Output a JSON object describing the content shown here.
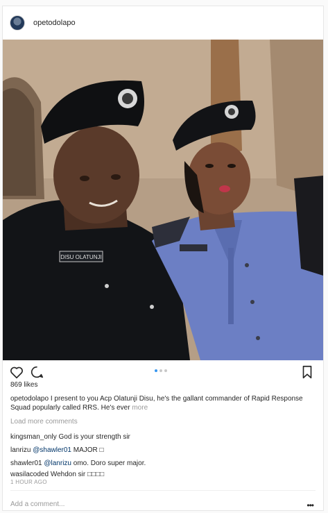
{
  "post": {
    "username": "opetodolapo",
    "likes": "869 likes",
    "caption": {
      "user": "opetodolapo",
      "text": "I present to you Acp Olatunji Disu, he's the gallant commander of Rapid Response Squad popularly called RRS. He's ever",
      "more": "more"
    },
    "load_more": "Load more comments",
    "comments": [
      {
        "user": "kingsman_only",
        "text": "God is your strength sir"
      },
      {
        "user": "lanrizu",
        "mention": "@shawler01",
        "text": "MAJOR □"
      },
      {
        "user": "shawler01",
        "mention": "@lanrizu",
        "text": "omo. Doro super major."
      },
      {
        "user": "wasilacoded",
        "text": "Wehdon sir □□□□"
      }
    ],
    "timestamp": "1 HOUR AGO",
    "add_comment_placeholder": "Add a comment...",
    "more_options": "•••"
  },
  "photo": {
    "nametag": "DISU OLATUNJI"
  },
  "carousel": {
    "count": 3,
    "active": 0
  },
  "icons": {
    "like": "heart-icon",
    "comment": "comment-bubble-icon",
    "save": "bookmark-icon"
  },
  "colors": {
    "link": "#003569",
    "muted": "#999999",
    "carousel_active": "#3897f0"
  }
}
